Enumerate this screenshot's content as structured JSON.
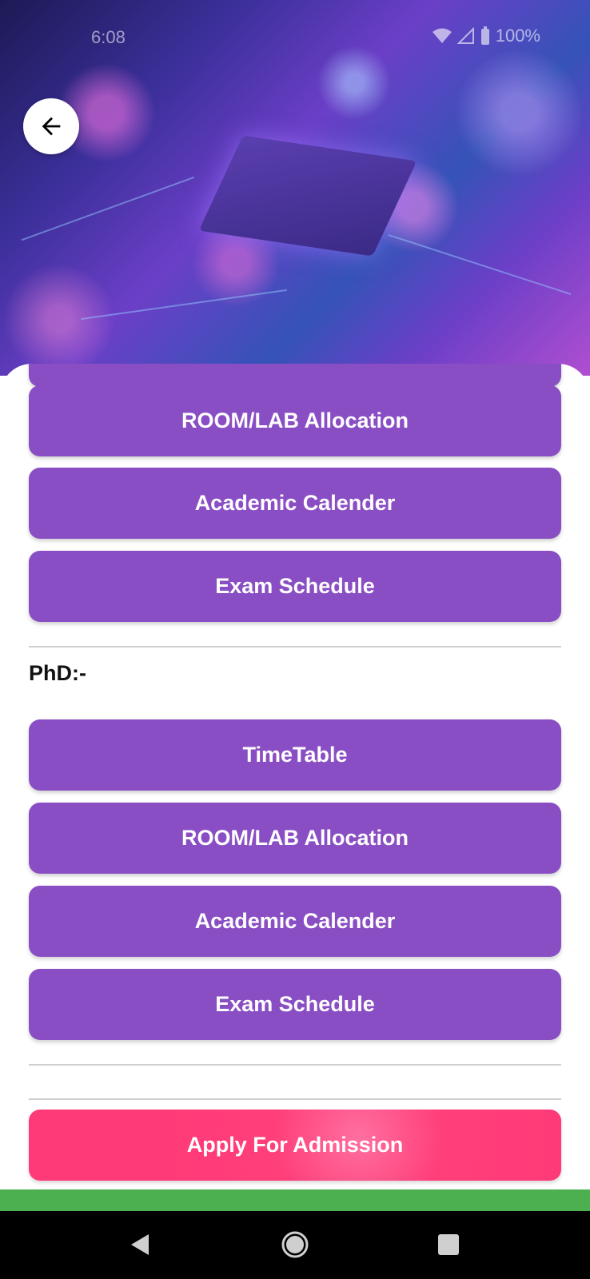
{
  "status_bar": {
    "time": "6:08",
    "battery": "100%"
  },
  "undergrad_buttons": [
    {
      "label": "ROOM/LAB Allocation"
    },
    {
      "label": "Academic Calender"
    },
    {
      "label": "Exam Schedule"
    }
  ],
  "phd": {
    "label": "PhD:-",
    "buttons": [
      {
        "label": "TimeTable"
      },
      {
        "label": "ROOM/LAB Allocation"
      },
      {
        "label": "Academic Calender"
      },
      {
        "label": "Exam Schedule"
      }
    ]
  },
  "apply_button": {
    "label": "Apply For Admission"
  },
  "colors": {
    "button_purple": "#8a4ec4",
    "apply_pink": "#ff3f7a",
    "footer_green": "#4caf50"
  }
}
